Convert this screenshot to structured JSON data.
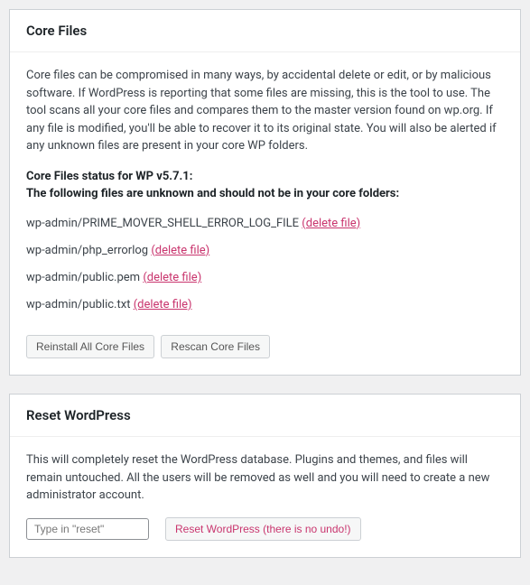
{
  "coreFiles": {
    "title": "Core Files",
    "description": "Core files can be compromised in many ways, by accidental delete or edit, or by malicious software. If WordPress is reporting that some files are missing, this is the tool to use. The tool scans all your core files and compares them to the master version found on wp.org. If any file is modified, you'll be able to recover it to its original state. You will also be alerted if any unknown files are present in your core WP folders.",
    "statusLine1": "Core Files status for WP v5.7.1:",
    "statusLine2": "The following files are unknown and should not be in your core folders:",
    "files": [
      {
        "path": "wp-admin/PRIME_MOVER_SHELL_ERROR_LOG_FILE",
        "action": "(delete file)"
      },
      {
        "path": "wp-admin/php_errorlog",
        "action": "(delete file)"
      },
      {
        "path": "wp-admin/public.pem",
        "action": "(delete file)"
      },
      {
        "path": "wp-admin/public.txt",
        "action": "(delete file)"
      }
    ],
    "reinstallLabel": "Reinstall All Core Files",
    "rescanLabel": "Rescan Core Files"
  },
  "resetWp": {
    "title": "Reset WordPress",
    "description": "This will completely reset the WordPress database. Plugins and themes, and files will remain untouched. All the users will be removed as well and you will need to create a new administrator account.",
    "inputPlaceholder": "Type in \"reset\"",
    "buttonLabel": "Reset WordPress (there is no undo!)"
  }
}
